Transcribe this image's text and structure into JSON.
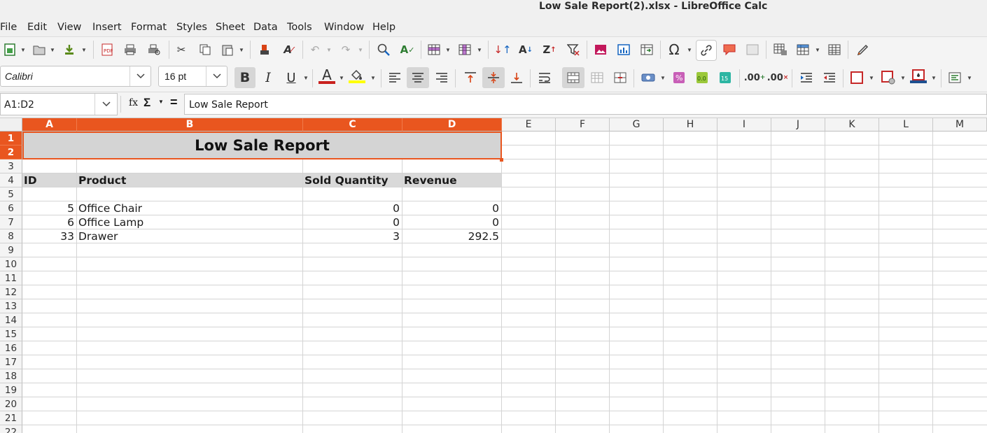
{
  "window": {
    "title": "Low Sale Report(2).xlsx - LibreOffice Calc"
  },
  "menu": [
    "File",
    "Edit",
    "View",
    "Insert",
    "Format",
    "Styles",
    "Sheet",
    "Data",
    "Tools",
    "Window",
    "Help"
  ],
  "format_toolbar": {
    "font_name": "Calibri",
    "font_size": "16 pt"
  },
  "formula_bar": {
    "name_box": "A1:D2",
    "content": "Low Sale Report",
    "fx_label": "fx",
    "sigma": "Σ",
    "equals": "="
  },
  "columns": [
    "A",
    "B",
    "C",
    "D",
    "E",
    "F",
    "G",
    "H",
    "I",
    "J",
    "K",
    "L",
    "M"
  ],
  "rows": [
    "1",
    "2",
    "3",
    "4",
    "5",
    "6",
    "7",
    "8",
    "9",
    "10",
    "11",
    "12",
    "13",
    "14",
    "15",
    "16",
    "17",
    "18",
    "19",
    "20",
    "21",
    "22"
  ],
  "sheet": {
    "title": "Low Sale Report",
    "headers": [
      "ID",
      "Product",
      "Sold Quantity",
      "Revenue"
    ],
    "records": [
      {
        "id": "5",
        "product": "Office Chair",
        "qty": "0",
        "revenue": "0"
      },
      {
        "id": "6",
        "product": "Office Lamp",
        "qty": "0",
        "revenue": "0"
      },
      {
        "id": "33",
        "product": "Drawer",
        "qty": "3",
        "revenue": "292.5"
      }
    ]
  },
  "colors": {
    "selection_accent": "#e9561f",
    "header_fill": "#d9d9d9",
    "title_fill": "#d4d4d4"
  }
}
